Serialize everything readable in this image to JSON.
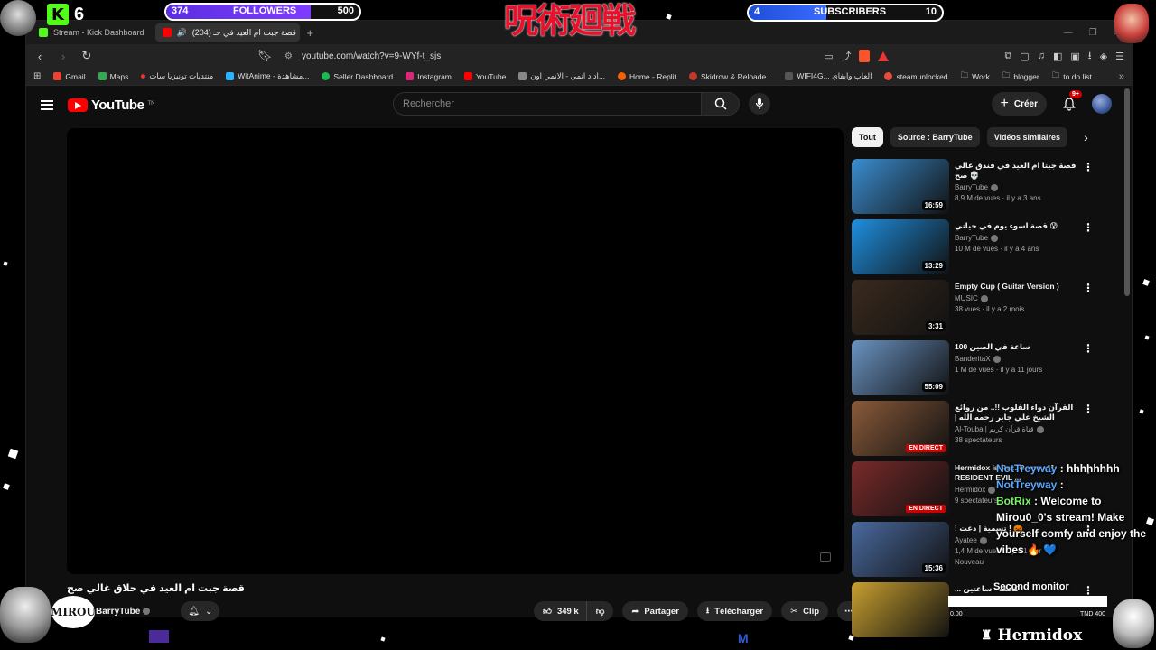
{
  "overlay": {
    "kick_count": "6",
    "followers": {
      "current": "374",
      "label": "FOLLOWERS",
      "goal": "500",
      "progress": 0.748
    },
    "subscribers": {
      "current": "4",
      "label": "SUBSCRIBERS",
      "goal": "10",
      "progress": 0.4
    },
    "jjk_title": "呪術廻戦",
    "mirou_logo": "MIROU",
    "second_monitor": "Second monitor",
    "mini_left": "0.00",
    "mini_right": "TND 400",
    "bottom_brand": "Hermidox"
  },
  "browser": {
    "tabs": [
      {
        "label": "Stream - Kick Dashboard",
        "favicon_color": "#53fc18"
      },
      {
        "label": "(204) قصة جبت ام العيد في حـ",
        "favicon_color": "#ff0000"
      }
    ],
    "new_tab": "+",
    "url": "youtube.com/watch?v=9-WYf-t_sjs",
    "bookmarks": [
      {
        "label": "Gmail",
        "color": "#ea4335"
      },
      {
        "label": "Maps",
        "color": "#34a853"
      },
      {
        "label": "منتديات تونيزيا سات",
        "color": "#e33"
      },
      {
        "label": "WitAnime - مشاهدة...",
        "color": "#2bb3ff"
      },
      {
        "label": "Seller Dashboard",
        "color": "#1db954"
      },
      {
        "label": "Instagram",
        "color": "#d62976"
      },
      {
        "label": "YouTube",
        "color": "#ff0000"
      },
      {
        "label": "اداد انمي - الانمي اون...",
        "color": "#888"
      },
      {
        "label": "Home - Replit",
        "color": "#f26207"
      },
      {
        "label": "Skidrow & Reloade...",
        "color": "#c0392b"
      },
      {
        "label": "WIFI4G... العاب وايفاي",
        "color": "#555"
      },
      {
        "label": "steamunlocked",
        "color": "#e74c3c"
      },
      {
        "label": "Work",
        "color": "#bbb"
      },
      {
        "label": "blogger",
        "color": "#bbb"
      },
      {
        "label": "to do list",
        "color": "#bbb"
      }
    ]
  },
  "youtube": {
    "search_placeholder": "Rechercher",
    "create_label": "Créer",
    "notif_badge": "9+",
    "video_title": "قصة جبت ام العيد في حلاق غالي صح",
    "channel_name": "BarryTube",
    "likes": "349 k",
    "share_label": "Partager",
    "download_label": "Télécharger",
    "clip_label": "Clip",
    "chips": [
      "Tout",
      "Source : BarryTube",
      "Vidéos similaires"
    ],
    "recommendations": [
      {
        "title": "قصة جبتا ام العيد في فندق غالي صح 💀",
        "channel": "BarryTube",
        "stats": "8,9 M de vues · il y a 3 ans",
        "duration": "16:59",
        "live": "",
        "thumb": "#3b8ed1"
      },
      {
        "title": "قصة اسوء يوم في حياتي 😰",
        "channel": "BarryTube",
        "stats": "10 M de vues · il y a 4 ans",
        "duration": "13:29",
        "live": "",
        "thumb": "#1f8fe0"
      },
      {
        "title": "Empty Cup ( Guitar Version )",
        "channel": "MUSIC",
        "stats": "38 vues · il y a 2 mois",
        "duration": "3:31",
        "live": "",
        "thumb": "#3a2a1e"
      },
      {
        "title": "100 ساعة في الصين",
        "channel": "BanderitaX",
        "stats": "1 M de vues · il y a 11 jours",
        "duration": "55:09",
        "live": "",
        "thumb": "#6a93c2"
      },
      {
        "title": "القرآن دواء القلوب !!.. من روائع الشيخ علي جابر رحمه الله | القرية بث مباشر",
        "channel": "Al-Touba | قناة قرآن كريم",
        "stats": "38 spectateurs",
        "duration": "",
        "live": "EN DIRECT",
        "thumb": "#8a5a3a"
      },
      {
        "title": "Hermidox is Re... Game +1] RESIDENT EVIL ...",
        "channel": "Hermidox",
        "stats": "9 spectateurs",
        "duration": "",
        "live": "EN DIRECT",
        "thumb": "#7a2a2a"
      },
      {
        "title": "! تسمية | دعت ! 🎃",
        "channel": "Ayatee",
        "stats": "1,4 M de vues · il y a 1 jour",
        "duration": "15:36",
        "live": "",
        "thumb": "#4a6aa0",
        "extra": "Nouveau"
      },
      {
        "title": "... كاملة - ساعتين",
        "channel": "...of Drama | ضوف دراما",
        "stats": "",
        "duration": "",
        "live": "",
        "thumb": "#c8a030"
      }
    ]
  },
  "chat": [
    {
      "user": "NotTreyway",
      "text": ": hhhhhhhh"
    },
    {
      "user": "NotTreyway",
      "text": ":"
    },
    {
      "user": "BotRix",
      "text": ": Welcome to Mirou0_0's stream! Make yourself comfy and enjoy the vibes 🔥 💙"
    }
  ]
}
